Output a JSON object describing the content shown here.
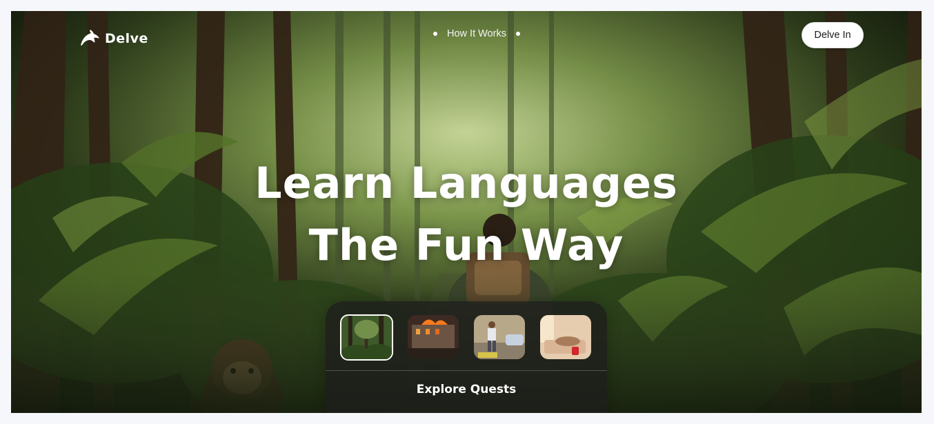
{
  "brand": {
    "name": "Delve",
    "logo_icon": "dolphin-icon"
  },
  "nav": {
    "link_label": "How It Works"
  },
  "cta": {
    "label": "Delve In"
  },
  "hero": {
    "title_line1": "Learn Languages",
    "title_line2": "The Fun Way"
  },
  "quests": {
    "label": "Explore Quests",
    "thumbnails": [
      {
        "name": "jungle-quest",
        "active": true
      },
      {
        "name": "burning-city-quest",
        "active": false
      },
      {
        "name": "street-quest",
        "active": false
      },
      {
        "name": "bedroom-quest",
        "active": false
      }
    ]
  },
  "colors": {
    "page_background": "#f5f7fa",
    "button_background": "#ffffff",
    "text_on_image": "#ffffff",
    "panel_background": "#1e1e1c"
  }
}
